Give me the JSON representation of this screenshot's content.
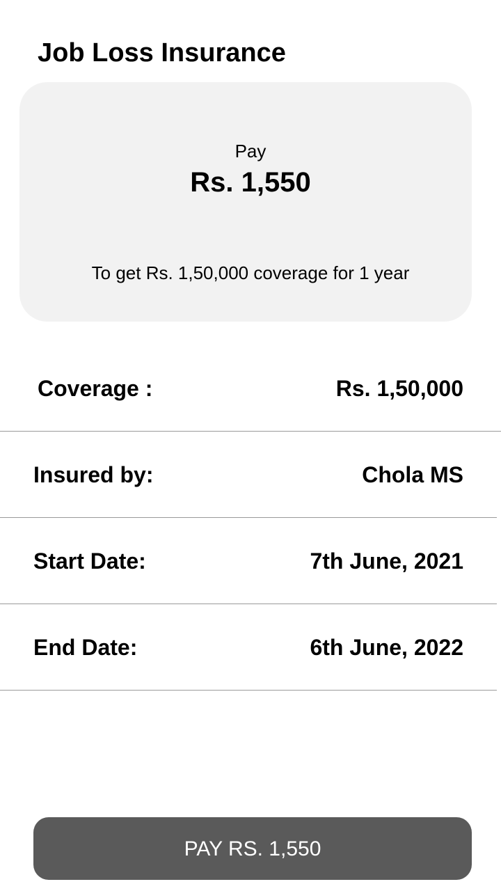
{
  "header": {
    "title": "Job Loss Insurance"
  },
  "summary": {
    "pay_label": "Pay",
    "pay_amount": "Rs. 1,550",
    "coverage_note": "To get Rs. 1,50,000 coverage for 1 year"
  },
  "details": [
    {
      "label": "Coverage :",
      "value": "Rs. 1,50,000"
    },
    {
      "label": "Insured by:",
      "value": "Chola MS"
    },
    {
      "label": "Start Date:",
      "value": "7th June, 2021"
    },
    {
      "label": "End Date:",
      "value": "6th June, 2022"
    }
  ],
  "footer": {
    "pay_button_label": "PAY RS. 1,550"
  },
  "colors": {
    "card_background": "#f2f2f2",
    "button_background": "#5a5a5a",
    "button_text": "#ffffff",
    "divider": "#9a9a9a"
  }
}
